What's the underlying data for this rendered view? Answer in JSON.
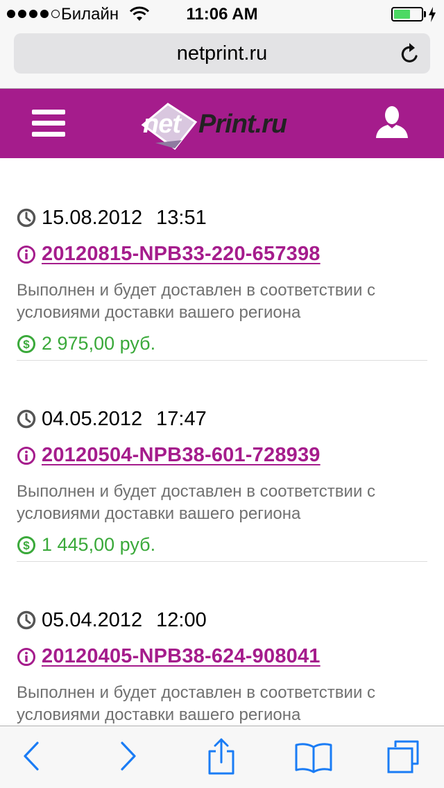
{
  "status_bar": {
    "carrier": "Билайн",
    "time": "11:06 AM",
    "battery_level": 0.6
  },
  "browser": {
    "url": "netprint.ru"
  },
  "site": {
    "logo_net": "net",
    "logo_print": "Print.ru"
  },
  "orders": [
    {
      "date": "15.08.2012",
      "time": "13:51",
      "number": "20120815-NPB33-220-657398",
      "status": "Выполнен и будет доставлен в соответствии с условиями доставки вашего региона",
      "price": "2 975,00 руб."
    },
    {
      "date": "04.05.2012",
      "time": "17:47",
      "number": "20120504-NPB38-601-728939",
      "status": "Выполнен и будет доставлен в соответствии с условиями доставки вашего региона",
      "price": "1 445,00 руб."
    },
    {
      "date": "05.04.2012",
      "time": "12:00",
      "number": "20120405-NPB38-624-908041",
      "status": "Выполнен и будет доставлен в соответствии с условиями доставки вашего региона",
      "price": ""
    }
  ],
  "colors": {
    "brand": "#a51c8c",
    "price": "#3aa93a",
    "status_text": "#707070",
    "ios_blue": "#1a7cf5"
  },
  "icons": {
    "date": "clock-icon",
    "number": "info-icon",
    "price": "dollar-icon"
  }
}
